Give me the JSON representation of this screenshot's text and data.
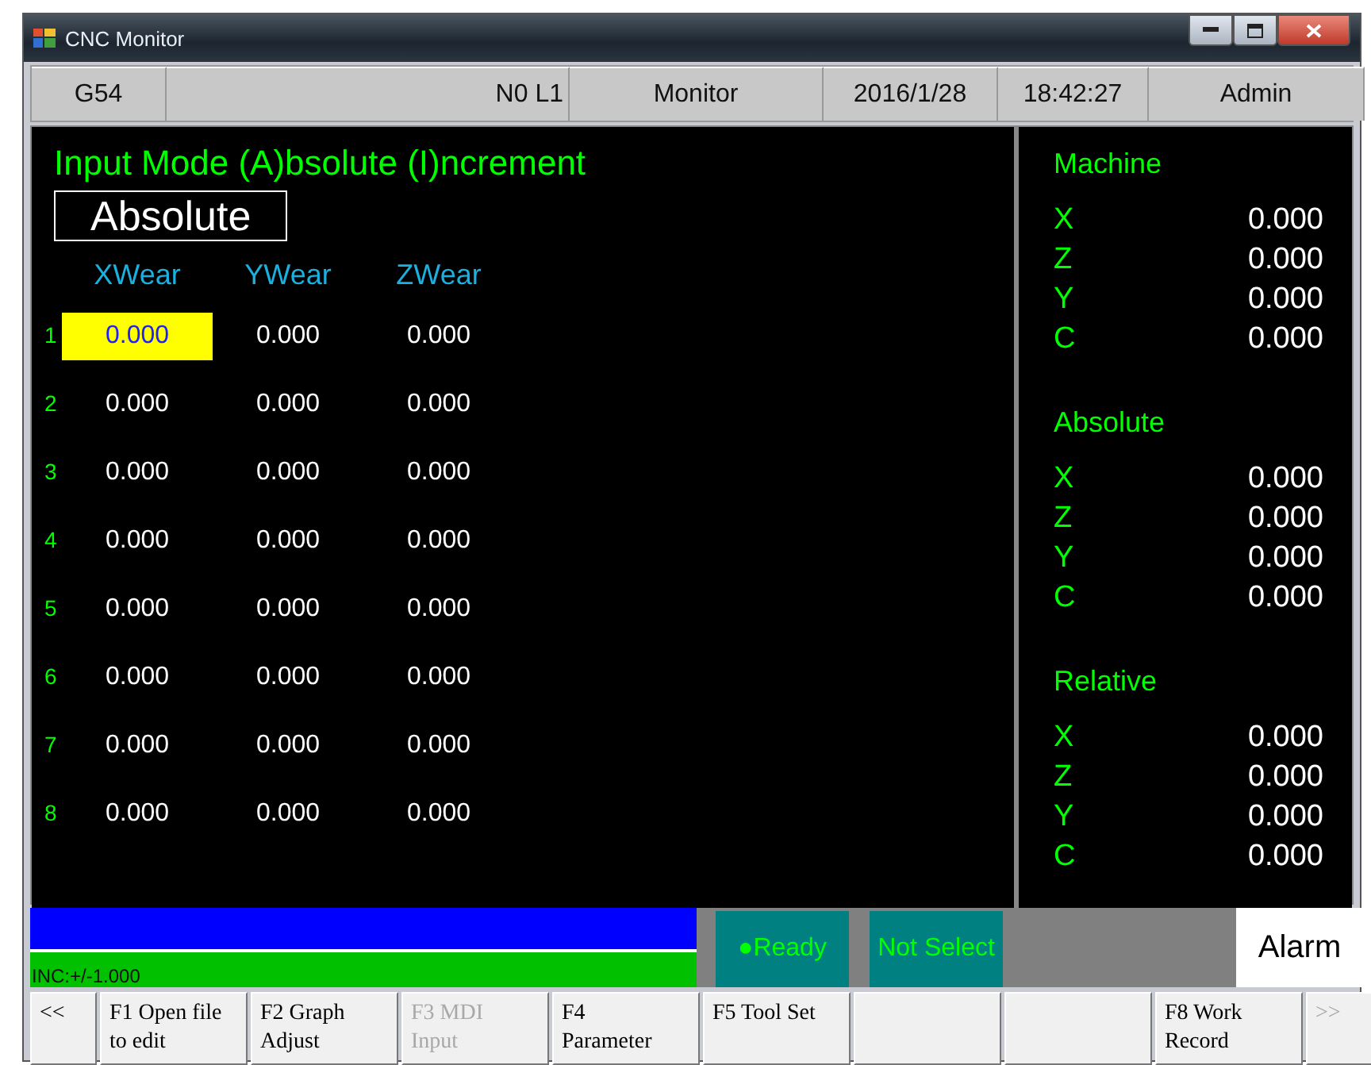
{
  "window": {
    "title": "CNC Monitor"
  },
  "header": [
    "G54",
    "N0 L1",
    "Monitor",
    "2016/1/28",
    "18:42:27",
    "Admin"
  ],
  "input_mode": {
    "title": "Input Mode (A)bsolute (I)ncrement",
    "value": "Absolute"
  },
  "wear_table": {
    "columns": [
      "XWear",
      "YWear",
      "ZWear"
    ],
    "rows": [
      {
        "index": "1",
        "cells": [
          {
            "value": "0.000",
            "selected": true
          },
          {
            "value": "0.000",
            "selected": false
          },
          {
            "value": "0.000",
            "selected": false
          }
        ]
      },
      {
        "index": "2",
        "cells": [
          {
            "value": "0.000",
            "selected": false
          },
          {
            "value": "0.000",
            "selected": false
          },
          {
            "value": "0.000",
            "selected": false
          }
        ]
      },
      {
        "index": "3",
        "cells": [
          {
            "value": "0.000",
            "selected": false
          },
          {
            "value": "0.000",
            "selected": false
          },
          {
            "value": "0.000",
            "selected": false
          }
        ]
      },
      {
        "index": "4",
        "cells": [
          {
            "value": "0.000",
            "selected": false
          },
          {
            "value": "0.000",
            "selected": false
          },
          {
            "value": "0.000",
            "selected": false
          }
        ]
      },
      {
        "index": "5",
        "cells": [
          {
            "value": "0.000",
            "selected": false
          },
          {
            "value": "0.000",
            "selected": false
          },
          {
            "value": "0.000",
            "selected": false
          }
        ]
      },
      {
        "index": "6",
        "cells": [
          {
            "value": "0.000",
            "selected": false
          },
          {
            "value": "0.000",
            "selected": false
          },
          {
            "value": "0.000",
            "selected": false
          }
        ]
      },
      {
        "index": "7",
        "cells": [
          {
            "value": "0.000",
            "selected": false
          },
          {
            "value": "0.000",
            "selected": false
          },
          {
            "value": "0.000",
            "selected": false
          }
        ]
      },
      {
        "index": "8",
        "cells": [
          {
            "value": "0.000",
            "selected": false
          },
          {
            "value": "0.000",
            "selected": false
          },
          {
            "value": "0.000",
            "selected": false
          }
        ]
      }
    ]
  },
  "positions": [
    {
      "title": "Machine",
      "axes": [
        {
          "axis": "X",
          "value": "0.000"
        },
        {
          "axis": "Z",
          "value": "0.000"
        },
        {
          "axis": "Y",
          "value": "0.000"
        },
        {
          "axis": "C",
          "value": "0.000"
        }
      ]
    },
    {
      "title": "Absolute",
      "axes": [
        {
          "axis": "X",
          "value": "0.000"
        },
        {
          "axis": "Z",
          "value": "0.000"
        },
        {
          "axis": "Y",
          "value": "0.000"
        },
        {
          "axis": "C",
          "value": "0.000"
        }
      ]
    },
    {
      "title": "Relative",
      "axes": [
        {
          "axis": "X",
          "value": "0.000"
        },
        {
          "axis": "Z",
          "value": "0.000"
        },
        {
          "axis": "Y",
          "value": "0.000"
        },
        {
          "axis": "C",
          "value": "0.000"
        }
      ]
    }
  ],
  "status": {
    "increment": "INC:+/-1.000",
    "ready": "●Ready",
    "selection": "Not Select",
    "alarm": "Alarm"
  },
  "function_keys": [
    {
      "kind": "key",
      "label": "<<",
      "disabled": false
    },
    {
      "kind": "key",
      "label": "F1 Open file\nto edit",
      "disabled": false
    },
    {
      "kind": "key",
      "label": "F2 Graph\nAdjust",
      "disabled": false
    },
    {
      "kind": "key",
      "label": "F3 MDI\nInput",
      "disabled": true
    },
    {
      "kind": "key",
      "label": "F4\nParameter",
      "disabled": false
    },
    {
      "kind": "key",
      "label": "F5 Tool Set",
      "disabled": false
    },
    {
      "kind": "blank"
    },
    {
      "kind": "blank"
    },
    {
      "kind": "key",
      "label": "F8 Work\nRecord",
      "disabled": false
    },
    {
      "kind": "key",
      "label": ">>",
      "disabled": true
    }
  ]
}
